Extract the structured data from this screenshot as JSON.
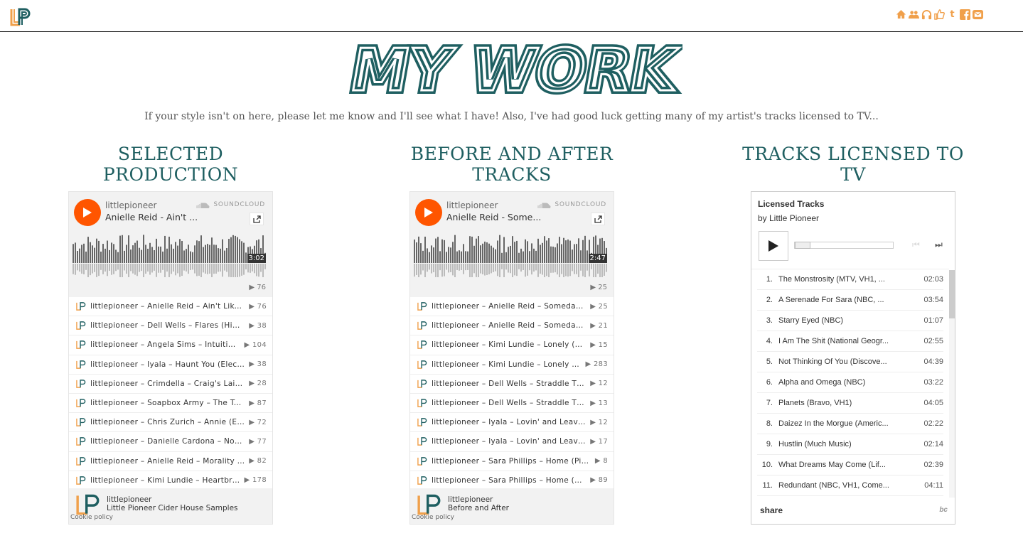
{
  "header": {
    "logo_text": "LP"
  },
  "nav_icons": [
    "home-icon",
    "group-icon",
    "headphones-icon",
    "thumbs-up-icon",
    "tumblr-icon",
    "facebook-icon",
    "envelope-icon"
  ],
  "colors": {
    "accent": "#f0a04b",
    "teal": "#1f5f61",
    "soundcloud_orange": "#ff5500"
  },
  "hero": {
    "title": "MY WORK"
  },
  "intro": "If your style isn't on here, please let me know and I'll see what I have! Also, I've had good luck getting many of my artist's tracks licensed to TV...",
  "columns": [
    {
      "title_line1": "SELECTED",
      "title_line2": "PRODUCTION"
    },
    {
      "title_line1": "BEFORE AND AFTER",
      "title_line2": "TRACKS"
    },
    {
      "title_line1": "TRACKS LICENSED TO",
      "title_line2": "TV"
    }
  ],
  "soundcloud": {
    "brand": "SOUNDCLOUD",
    "cookie": "Cookie policy"
  },
  "widget1": {
    "user": "littlepioneer",
    "current_title": "Anielle Reid - Ain't ...",
    "duration": "3:02",
    "plays": "▶ 76",
    "tracks": [
      {
        "title": "littlepioneer – Anielle Reid – Ain't Like Me",
        "plays": "▶ 76"
      },
      {
        "title": "littlepioneer – Dell Wells – Flares (Hip Hop)",
        "plays": "▶ 38"
      },
      {
        "title": "littlepioneer – Angela Sims – Intuition (Pop)",
        "plays": "▶ 104"
      },
      {
        "title": "littlepioneer – Iyala – Haunt You (Electronic)",
        "plays": "▶ 38"
      },
      {
        "title": "littlepioneer – Crimdella – Craig's Lair (Rock)",
        "plays": "▶ 28"
      },
      {
        "title": "littlepioneer – Soapbox Army – The Top (Rock)",
        "plays": "▶ 87"
      },
      {
        "title": "littlepioneer – Chris Zurich – Annie (Electronic)",
        "plays": "▶ 72"
      },
      {
        "title": "littlepioneer – Danielle Cardona – Not Enough",
        "plays": "▶ 77"
      },
      {
        "title": "littlepioneer – Anielle Reid – Morality (Pop)",
        "plays": "▶ 82"
      },
      {
        "title": "littlepioneer – Kimi Lundie – Heartbreaker",
        "plays": "▶ 178"
      }
    ],
    "footer_user": "littlepioneer",
    "footer_playlist": "Little Pioneer Cider House Samples"
  },
  "widget2": {
    "user": "littlepioneer",
    "current_title": "Anielle Reid - Some...",
    "duration": "2:47",
    "plays": "▶ 25",
    "tracks": [
      {
        "title": "littlepioneer – Anielle Reid – Someday (Demo)",
        "plays": "▶ 25"
      },
      {
        "title": "littlepioneer – Anielle Reid – Someday (Final)",
        "plays": "▶ 21"
      },
      {
        "title": "littlepioneer – Kimi Lundie – Lonely (Demo)",
        "plays": "▶ 15"
      },
      {
        "title": "littlepioneer – Kimi Lundie – Lonely (Final)",
        "plays": "▶ 283"
      },
      {
        "title": "littlepioneer – Dell Wells – Straddle The Line",
        "plays": "▶ 12"
      },
      {
        "title": "littlepioneer – Dell Wells – Straddle The Line",
        "plays": "▶ 13"
      },
      {
        "title": "littlepioneer – Iyala – Lovin' and Leavin' (Demo)",
        "plays": "▶ 12"
      },
      {
        "title": "littlepioneer – Iyala – Lovin' and Leavin' (Final)",
        "plays": "▶ 17"
      },
      {
        "title": "littlepioneer – Sara Phillips – Home (Piano)",
        "plays": "▶ 8"
      },
      {
        "title": "littlepioneer – Sara Phillips – Home (Full)",
        "plays": "▶ 89"
      }
    ],
    "footer_user": "littlepioneer",
    "footer_playlist": "Before and After"
  },
  "bandcamp": {
    "title": "Licensed Tracks",
    "by": "by Little Pioneer",
    "share": "share",
    "logo": "bc",
    "tracks": [
      {
        "n": "1.",
        "title": "The Monstrosity (MTV, VH1, ...",
        "dur": "02:03"
      },
      {
        "n": "2.",
        "title": "A Serenade For Sara (NBC, ...",
        "dur": "03:54"
      },
      {
        "n": "3.",
        "title": "Starry Eyed (NBC)",
        "dur": "01:07"
      },
      {
        "n": "4.",
        "title": "I Am The Shit (National Geogr...",
        "dur": "02:55"
      },
      {
        "n": "5.",
        "title": "Not Thinking Of You (Discove...",
        "dur": "04:39"
      },
      {
        "n": "6.",
        "title": "Alpha and Omega (NBC)",
        "dur": "03:22"
      },
      {
        "n": "7.",
        "title": "Planets (Bravo, VH1)",
        "dur": "04:05"
      },
      {
        "n": "8.",
        "title": "Daizez In the Morgue (Americ...",
        "dur": "02:22"
      },
      {
        "n": "9.",
        "title": "Hustlin (Much Music)",
        "dur": "02:14"
      },
      {
        "n": "10.",
        "title": "What Dreams May Come (Lif...",
        "dur": "02:39"
      },
      {
        "n": "11.",
        "title": "Redundant (NBC, VH1, Come...",
        "dur": "04:11"
      }
    ]
  }
}
